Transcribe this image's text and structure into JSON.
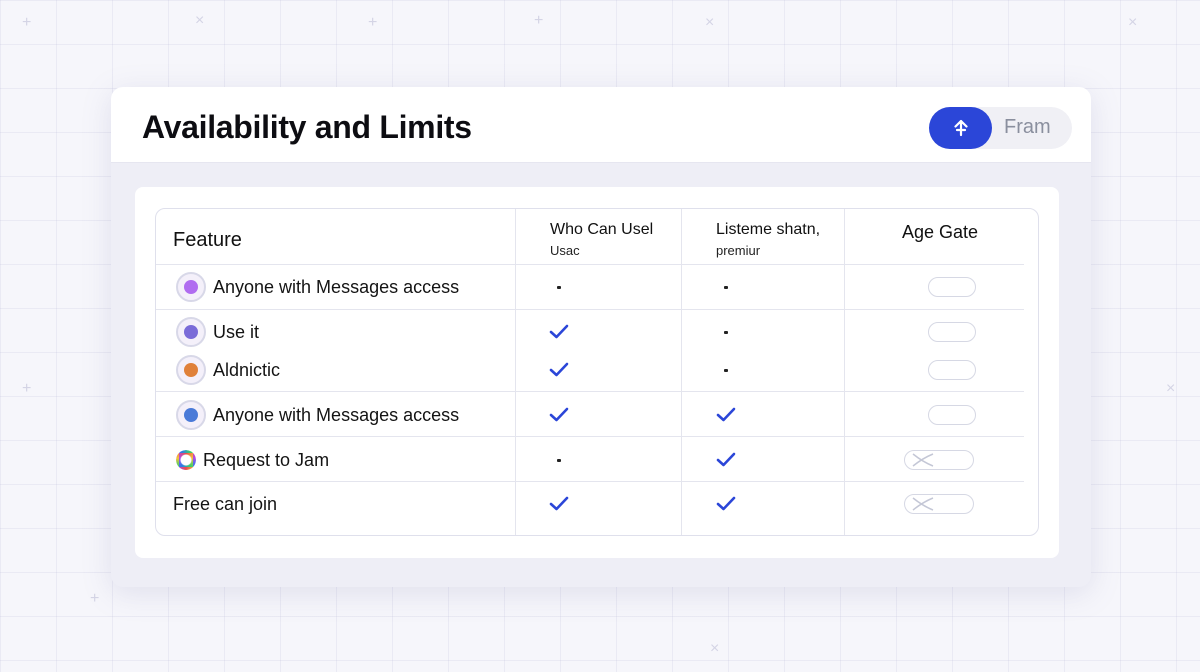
{
  "page": {
    "title": "Availability and Limits",
    "toolbar": {
      "button_icon": "share-arrow-icon",
      "secondary_label": "Fram"
    },
    "accent_color": "#2b46d8"
  },
  "table": {
    "headers": {
      "feature": "Feature",
      "who": "Who Can Usel",
      "who_sub": "Usac",
      "listen": "Listeme shatn,",
      "listen_sub": "premiur",
      "age": "Age Gate"
    },
    "rows": [
      {
        "label": "Anyone with Messages access",
        "icon": "avatar-icon",
        "who": "dot",
        "listen": "dot",
        "age_gate": "off"
      },
      {
        "label": "Use it",
        "icon": "avatar-icon",
        "who": "check",
        "listen": "dot",
        "age_gate": "off"
      },
      {
        "label": "Aldnictic",
        "icon": "avatar-icon",
        "who": "check",
        "listen": "dot",
        "age_gate": "off"
      },
      {
        "label": "Anyone with Messages access",
        "icon": "avatar-icon",
        "who": "check",
        "listen": "check",
        "age_gate": "off"
      },
      {
        "label": "Request to Jam",
        "icon": "ring-icon",
        "who": "dot",
        "listen": "check",
        "age_gate": "blocked"
      },
      {
        "label": "Free can join",
        "icon": "",
        "who": "check",
        "listen": "check",
        "age_gate": "blocked"
      }
    ],
    "check_color": "#2b46d8"
  }
}
